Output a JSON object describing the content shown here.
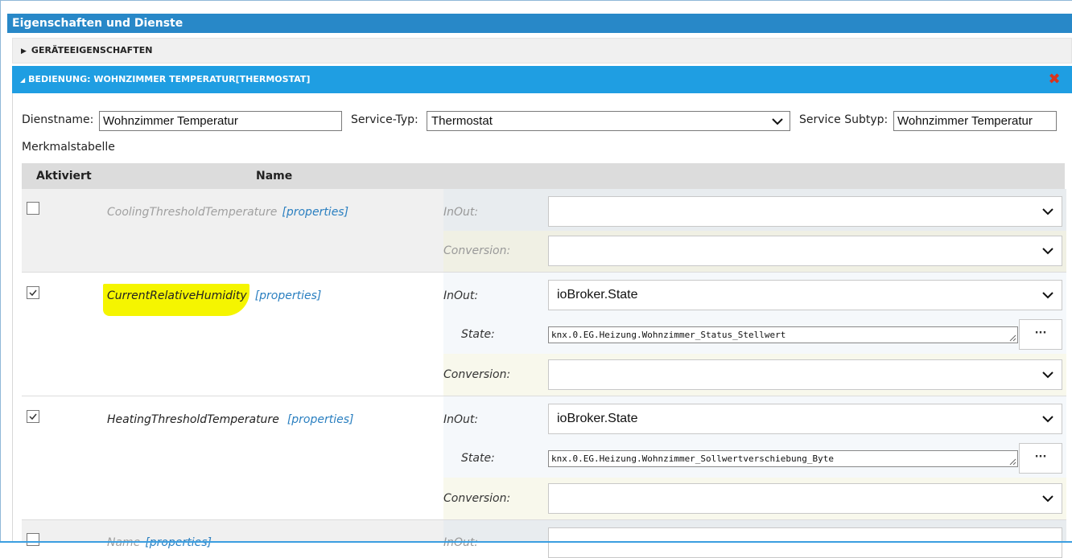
{
  "window": {
    "title": "Eigenschaften und Dienste"
  },
  "accordion": {
    "device_props": "GERÄTEEIGENSCHAFTEN",
    "service": "BEDIENUNG: WOHNZIMMER TEMPERATUR[THERMOSTAT]"
  },
  "form": {
    "dienstname_label": "Dienstname:",
    "dienstname_value": "Wohnzimmer Temperatur",
    "service_typ_label": "Service-Typ:",
    "service_typ_value": "Thermostat",
    "service_subtyp_label": "Service Subtyp:",
    "service_subtyp_value": "Wohnzimmer Temperatur",
    "merkmal_label": "Merkmalstabelle"
  },
  "table": {
    "headers": {
      "aktiviert": "Aktiviert",
      "name": "Name"
    },
    "labels": {
      "inout": "InOut:",
      "conversion": "Conversion:",
      "state": "State:",
      "properties": "[properties]",
      "more_button": "···"
    },
    "rows": [
      {
        "name": "CoolingThresholdTemperature",
        "checked": false,
        "inout": "",
        "conversion": ""
      },
      {
        "name": "CurrentRelativeHumidity",
        "checked": true,
        "highlighted": true,
        "inout": "ioBroker.State",
        "state": "knx.0.EG.Heizung.Wohnzimmer_Status_Stellwert",
        "conversion": ""
      },
      {
        "name": "HeatingThresholdTemperature",
        "checked": true,
        "inout": "ioBroker.State",
        "state": "knx.0.EG.Heizung.Wohnzimmer_Sollwertverschiebung_Byte",
        "conversion": ""
      },
      {
        "name": "Name",
        "checked": false,
        "inout": "",
        "conversion": ""
      }
    ]
  },
  "colors": {
    "titlebar": "#2888c8",
    "accordion_active": "#1f9ee2",
    "highlight": "#f5f500",
    "link": "#2a7fc0",
    "close": "#d9331c"
  }
}
